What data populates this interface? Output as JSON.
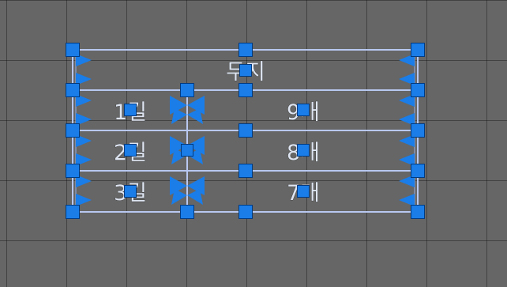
{
  "table": {
    "title": "두지",
    "rows": [
      {
        "left": "1길",
        "right": "9개"
      },
      {
        "left": "2길",
        "right": "8개"
      },
      {
        "left": "3길",
        "right": "7개"
      }
    ]
  },
  "colors": {
    "background": "#666666",
    "grid_line": "#555555",
    "border": "#b8c8f0",
    "handle": "#1a7de8",
    "handle_stroke": "#003a80",
    "text": "#dfe6f2"
  },
  "icons": {
    "resize_handle": "square-handle-icon",
    "row_resize_arrow": "resize-arrow-icon"
  }
}
